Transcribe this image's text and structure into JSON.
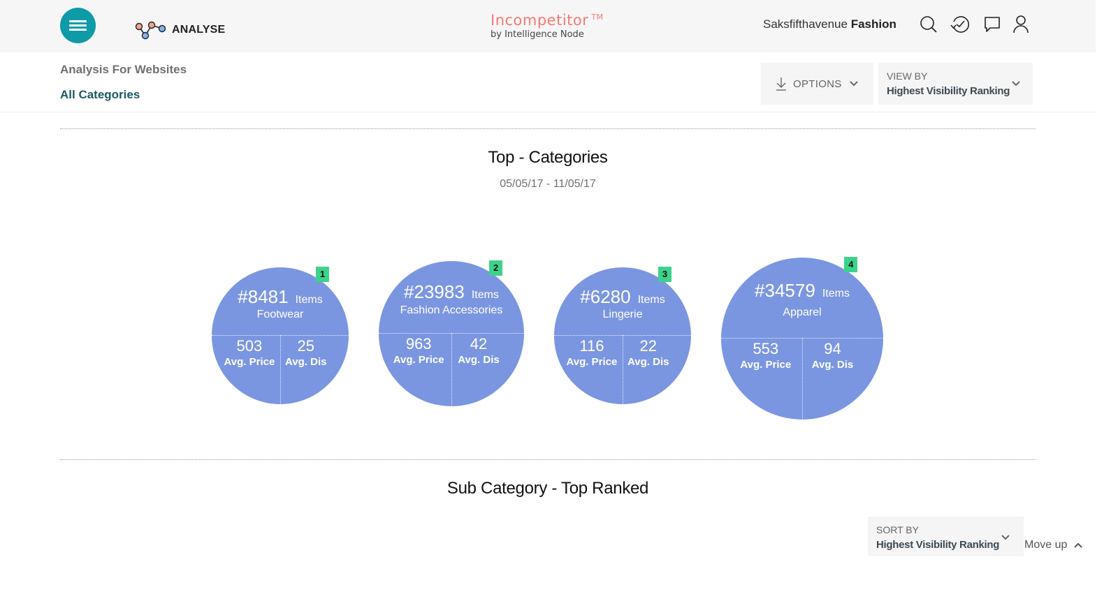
{
  "header": {
    "menu_icon": "hamburger-icon",
    "nav_label": "ANALYSE",
    "nav_icon": "analytics-nodes-icon",
    "brand_name": "Incompetitor",
    "brand_tm": "TM",
    "brand_sub": "by Intelligence Node",
    "store_name": "Saksfifthavenue",
    "store_category": "Fashion",
    "icons": [
      "search-icon",
      "history-icon",
      "chat-icon",
      "user-icon"
    ]
  },
  "subheader": {
    "label": "Analysis For Websites",
    "breadcrumb": "All Categories",
    "options_label": "OPTIONS",
    "view_by_label": "VIEW BY",
    "view_by_value": "Highest Visibility Ranking"
  },
  "top_categories": {
    "title": "Top - Categories",
    "date_range": "05/05/17 - 11/05/17",
    "items_label": "Items",
    "price_label": "Avg. Price",
    "dis_label": "Avg. Dis",
    "categories": [
      {
        "rank": "1",
        "count": "#8481",
        "name": "Footwear",
        "avg_price": "503",
        "avg_dis": "25"
      },
      {
        "rank": "2",
        "count": "#23983",
        "name": "Fashion Accessories",
        "avg_price": "963",
        "avg_dis": "42"
      },
      {
        "rank": "3",
        "count": "#6280",
        "name": "Lingerie",
        "avg_price": "116",
        "avg_dis": "22"
      },
      {
        "rank": "4",
        "count": "#34579",
        "name": "Apparel",
        "avg_price": "553",
        "avg_dis": "94"
      }
    ]
  },
  "sub_category": {
    "title": "Sub Category - Top Ranked",
    "sort_by_label": "SORT BY",
    "sort_by_value": "Highest Visibility Ranking",
    "move_up_label": "Move up"
  },
  "colors": {
    "accent_teal": "#0e9aa7",
    "brand_coral": "#f47b72",
    "bubble_blue": "#7b96e0",
    "rank_green": "#3dd28b",
    "breadcrumb": "#1c5a62"
  }
}
